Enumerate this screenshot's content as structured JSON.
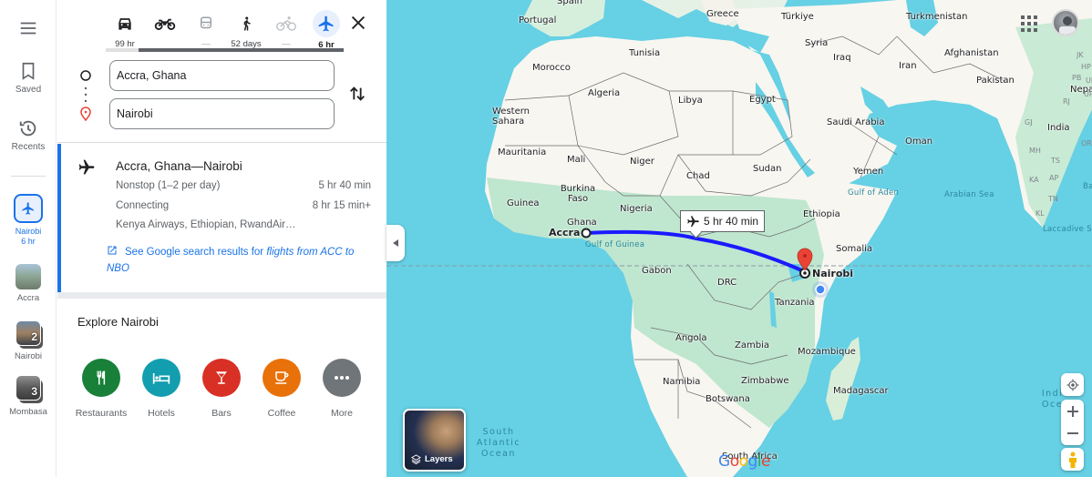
{
  "rail": {
    "menu_icon": "hamburger-menu-icon",
    "saved_label": "Saved",
    "recents_label": "Recents",
    "active_trip": {
      "line1": "Nairobi",
      "line2": "6 hr"
    },
    "recent_places": [
      {
        "label": "Accra",
        "count": ""
      },
      {
        "label": "Nairobi",
        "count": "2"
      },
      {
        "label": "Mombasa",
        "count": "3"
      }
    ]
  },
  "travel_modes": [
    {
      "name": "driving",
      "icon": "car-icon",
      "label": "99 hr",
      "state": "normal"
    },
    {
      "name": "motorcycle",
      "icon": "motorcycle-icon",
      "label": "",
      "state": "normal"
    },
    {
      "name": "transit",
      "icon": "train-icon",
      "label": "—",
      "state": "disabled"
    },
    {
      "name": "walking",
      "icon": "walking-icon",
      "label": "52 days",
      "state": "normal"
    },
    {
      "name": "cycling",
      "icon": "bicycle-icon",
      "label": "—",
      "state": "disabled"
    },
    {
      "name": "flights",
      "icon": "airplane-icon",
      "label": "6 hr",
      "state": "active"
    }
  ],
  "directions": {
    "origin": "Accra, Ghana",
    "destination": "Nairobi"
  },
  "flight_card": {
    "title": "Accra, Ghana—Nairobi",
    "rows": [
      {
        "left": "Nonstop (1–2 per day)",
        "right": "5 hr 40 min"
      },
      {
        "left": "Connecting",
        "right": "8 hr 15 min+"
      },
      {
        "left": "Kenya Airways, Ethiopian, RwandAir…",
        "right": ""
      }
    ],
    "link_prefix": "See Google search results for ",
    "link_italic": "flights from ACC to NBO"
  },
  "explore": {
    "title": "Explore Nairobi",
    "categories": [
      {
        "label": "Restaurants",
        "icon": "restaurant-icon",
        "color": "#188038"
      },
      {
        "label": "Hotels",
        "icon": "hotel-icon",
        "color": "#129eaf"
      },
      {
        "label": "Bars",
        "icon": "bar-icon",
        "color": "#d93025"
      },
      {
        "label": "Coffee",
        "icon": "coffee-icon",
        "color": "#e8710a"
      },
      {
        "label": "More",
        "icon": "more-icon",
        "color": "#70757a"
      }
    ]
  },
  "map": {
    "route_duration": "5 hr 40 min",
    "origin_label": "Accra",
    "destination_label": "Nairobi",
    "layers_label": "Layers",
    "logo": "Google",
    "colors": {
      "water": "#66d0e4",
      "land": "#f8f6f0",
      "green": "#bfe6cf",
      "route": "#1a1aff",
      "pin": "#ea4335"
    },
    "labels": {
      "countries": [
        "Spain",
        "Portugal",
        "Greece",
        "Türkiye",
        "Turkmenistan",
        "Tunisia",
        "Syria",
        "Iraq",
        "Iran",
        "Afghanistan",
        "Morocco",
        "Algeria",
        "Libya",
        "Egypt",
        "Pakistan",
        "Western Sahara",
        "Saudi Arabia",
        "India",
        "Nepal",
        "Mauritania",
        "Mali",
        "Niger",
        "Chad",
        "Sudan",
        "Oman",
        "Yemen",
        "Burkina Faso",
        "Guinea",
        "Nigeria",
        "Ethiopia",
        "Ghana",
        "Somalia",
        "Gabon",
        "DRC",
        "Tanzania",
        "Angola",
        "Zambia",
        "Mozambique",
        "Namibia",
        "Zimbabwe",
        "Botswana",
        "Madagascar",
        "South Africa"
      ],
      "seas": [
        "Gulf of Guinea",
        "Gulf of Aden",
        "Arabian Sea",
        "Laccadive Sea",
        "Bay"
      ],
      "oceans": [
        "South Atlantic Ocean",
        "Indian Ocean"
      ],
      "states": [
        "JK",
        "HP",
        "PB",
        "UK",
        "UP",
        "RJ",
        "GJ",
        "MH",
        "OR",
        "TS",
        "KA",
        "AP",
        "TN",
        "KL"
      ]
    }
  }
}
